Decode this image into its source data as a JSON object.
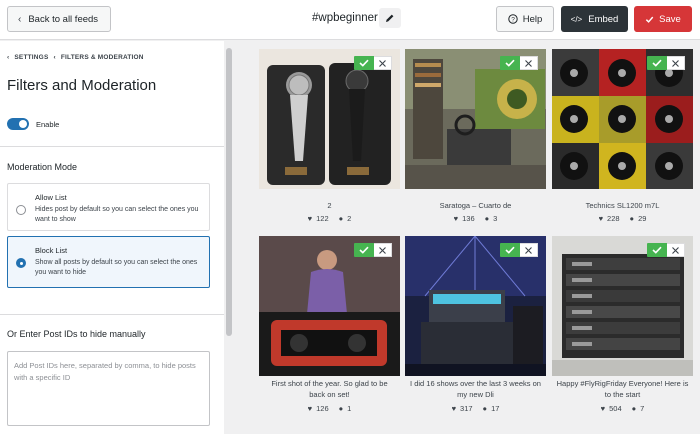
{
  "topbar": {
    "back_label": "Back to all feeds",
    "feed_name": "#wpbeginner",
    "help_label": "Help",
    "embed_label": "Embed",
    "save_label": "Save"
  },
  "sidebar": {
    "breadcrumb": [
      "SETTINGS",
      "FILTERS & MODERATION"
    ],
    "title": "Filters and Moderation",
    "enable_label": "Enable",
    "enabled": true,
    "moderation_title": "Moderation Mode",
    "options": [
      {
        "title": "Allow List",
        "desc": "Hides post by default so you can select the ones you want to show",
        "selected": false
      },
      {
        "title": "Block List",
        "desc": "Show all posts by default so you can select the ones you want to hide",
        "selected": true
      }
    ],
    "post_ids_title": "Or Enter Post IDs to hide manually",
    "post_ids_placeholder": "Add Post IDs here, separated by comma, to hide posts with a specific ID"
  },
  "posts": [
    {
      "caption": "2",
      "likes": "122",
      "comments": "2"
    },
    {
      "caption": "Saratoga – Cuarto de",
      "likes": "136",
      "comments": "3"
    },
    {
      "caption": "Technics SL1200 m7L",
      "likes": "228",
      "comments": "29"
    },
    {
      "caption": "First shot of the year. So glad to be back on set!",
      "likes": "126",
      "comments": "1"
    },
    {
      "caption": "I did 16 shows over the last 3 weeks on my new Dli",
      "likes": "317",
      "comments": "17"
    },
    {
      "caption": "Happy #FlyRigFriday Everyone! Here is to the start",
      "likes": "504",
      "comments": "7"
    }
  ],
  "colors": {
    "accent": "#2271b1",
    "approve": "#46b450",
    "save": "#d63638",
    "embed": "#2c3338"
  },
  "icons": [
    "chevron-left-icon",
    "pencil-icon",
    "help-circle-icon",
    "code-icon",
    "check-icon",
    "heart-icon",
    "comment-icon",
    "close-icon"
  ]
}
